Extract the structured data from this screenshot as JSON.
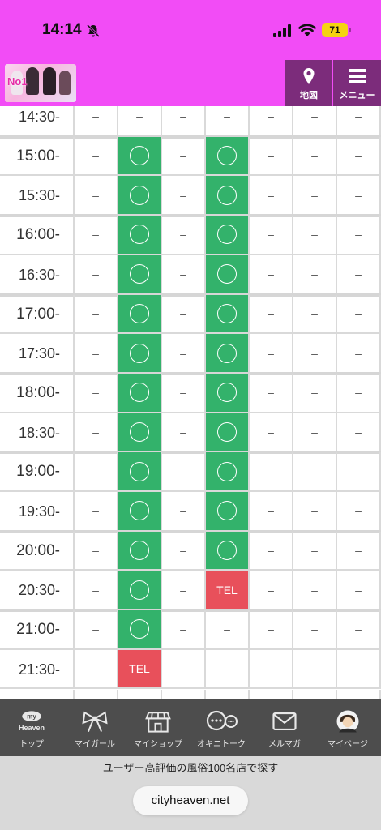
{
  "status_bar": {
    "time": "14:14",
    "battery": "71",
    "icons": [
      "bell-slash-icon",
      "signal-icon",
      "wifi-icon",
      "battery-icon"
    ]
  },
  "header": {
    "logo_text": "No1",
    "map_label": "地図",
    "menu_label": "メニュー",
    "colors": {
      "brand": "#f24cf6",
      "button": "#7c2c7b"
    }
  },
  "schedule": {
    "dash": "–",
    "tel_label": "TEL",
    "colors": {
      "available": "#33b26b",
      "tel": "#e8505b"
    },
    "rows": [
      {
        "time": "14:30-",
        "slots": [
          "dash",
          "dash",
          "dash",
          "dash",
          "dash",
          "dash",
          "dash"
        ]
      },
      {
        "time": "15:00-",
        "slots": [
          "dash",
          "ok",
          "dash",
          "ok",
          "dash",
          "dash",
          "dash"
        ]
      },
      {
        "time": "15:30-",
        "slots": [
          "dash",
          "ok",
          "dash",
          "ok",
          "dash",
          "dash",
          "dash"
        ]
      },
      {
        "time": "16:00-",
        "slots": [
          "dash",
          "ok",
          "dash",
          "ok",
          "dash",
          "dash",
          "dash"
        ]
      },
      {
        "time": "16:30-",
        "slots": [
          "dash",
          "ok",
          "dash",
          "ok",
          "dash",
          "dash",
          "dash"
        ]
      },
      {
        "time": "17:00-",
        "slots": [
          "dash",
          "ok",
          "dash",
          "ok",
          "dash",
          "dash",
          "dash"
        ]
      },
      {
        "time": "17:30-",
        "slots": [
          "dash",
          "ok",
          "dash",
          "ok",
          "dash",
          "dash",
          "dash"
        ]
      },
      {
        "time": "18:00-",
        "slots": [
          "dash",
          "ok",
          "dash",
          "ok",
          "dash",
          "dash",
          "dash"
        ]
      },
      {
        "time": "18:30-",
        "slots": [
          "dash",
          "ok",
          "dash",
          "ok",
          "dash",
          "dash",
          "dash"
        ]
      },
      {
        "time": "19:00-",
        "slots": [
          "dash",
          "ok",
          "dash",
          "ok",
          "dash",
          "dash",
          "dash"
        ]
      },
      {
        "time": "19:30-",
        "slots": [
          "dash",
          "ok",
          "dash",
          "ok",
          "dash",
          "dash",
          "dash"
        ]
      },
      {
        "time": "20:00-",
        "slots": [
          "dash",
          "ok",
          "dash",
          "ok",
          "dash",
          "dash",
          "dash"
        ]
      },
      {
        "time": "20:30-",
        "slots": [
          "dash",
          "ok",
          "dash",
          "tel",
          "dash",
          "dash",
          "dash"
        ]
      },
      {
        "time": "21:00-",
        "slots": [
          "dash",
          "ok",
          "dash",
          "dash",
          "dash",
          "dash",
          "dash"
        ]
      },
      {
        "time": "21:30-",
        "slots": [
          "dash",
          "tel",
          "dash",
          "dash",
          "dash",
          "dash",
          "dash"
        ]
      },
      {
        "time": "",
        "slots": [
          "none",
          "none",
          "none",
          "none",
          "none",
          "none",
          "none"
        ]
      }
    ]
  },
  "bottom_nav": {
    "items": [
      {
        "label": "トップ",
        "icon": "my-heaven-icon",
        "badge": "my\nHeaven"
      },
      {
        "label": "マイガール",
        "icon": "ribbon-icon"
      },
      {
        "label": "マイショップ",
        "icon": "shop-icon"
      },
      {
        "label": "オキニトーク",
        "icon": "chat-bubbles-icon"
      },
      {
        "label": "メルマガ",
        "icon": "mail-icon"
      },
      {
        "label": "マイページ",
        "icon": "avatar-icon"
      }
    ]
  },
  "footer": {
    "tagline": "ユーザー高評価の風俗100名店で探す",
    "url": "cityheaven.net"
  }
}
